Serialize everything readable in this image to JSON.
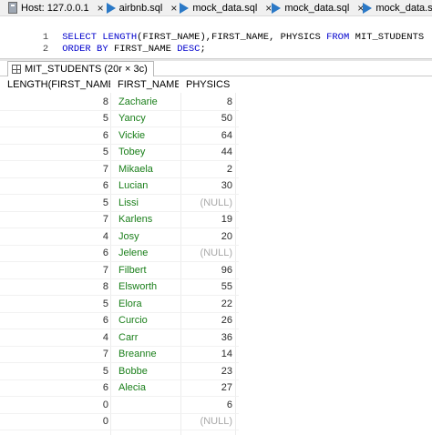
{
  "tabs": [
    {
      "label": "Host: 127.0.0.1",
      "icon": "host-icon"
    },
    {
      "label": "airbnb.sql",
      "icon": "query-run-icon"
    },
    {
      "label": "mock_data.sql",
      "icon": "query-run-icon"
    },
    {
      "label": "mock_data.sql",
      "icon": "query-run-icon"
    },
    {
      "label": "mock_data.sql*",
      "icon": "query-run-icon"
    }
  ],
  "close_glyph": "×",
  "editor": {
    "lines": [
      {
        "num": "1",
        "parts": [
          {
            "t": "SELECT ",
            "k": "kw"
          },
          {
            "t": "LENGTH",
            "k": "kw"
          },
          {
            "t": "(FIRST_NAME),FIRST_NAME, PHYSICS ",
            "k": "ident"
          },
          {
            "t": "FROM ",
            "k": "kw"
          },
          {
            "t": "MIT_STUDENTS",
            "k": "ident"
          }
        ]
      },
      {
        "num": "2",
        "parts": [
          {
            "t": "ORDER BY ",
            "k": "kw"
          },
          {
            "t": "FIRST_NAME ",
            "k": "ident"
          },
          {
            "t": "DESC",
            "k": "kw"
          },
          {
            "t": ";",
            "k": "ident"
          }
        ]
      }
    ]
  },
  "result_tab": {
    "label": "MIT_STUDENTS (20r × 3c)"
  },
  "columns": [
    "LENGTH(FIRST_NAME)",
    "FIRST_NAME",
    "PHYSICS"
  ],
  "null_text": "(NULL)",
  "rows": [
    [
      "8",
      "Zacharie",
      "8"
    ],
    [
      "5",
      "Yancy",
      "50"
    ],
    [
      "6",
      "Vickie",
      "64"
    ],
    [
      "5",
      "Tobey",
      "44"
    ],
    [
      "7",
      "Mikaela",
      "2"
    ],
    [
      "6",
      "Lucian",
      "30"
    ],
    [
      "5",
      "Lissi",
      null
    ],
    [
      "7",
      "Karlens",
      "19"
    ],
    [
      "4",
      "Josy",
      "20"
    ],
    [
      "6",
      "Jelene",
      null
    ],
    [
      "7",
      "Filbert",
      "96"
    ],
    [
      "8",
      "Elsworth",
      "55"
    ],
    [
      "5",
      "Elora",
      "22"
    ],
    [
      "6",
      "Curcio",
      "26"
    ],
    [
      "4",
      "Carr",
      "36"
    ],
    [
      "7",
      "Breanne",
      "14"
    ],
    [
      "5",
      "Bobbe",
      "23"
    ],
    [
      "6",
      "Alecia",
      "27"
    ],
    [
      "0",
      "",
      "6"
    ],
    [
      "0",
      "",
      null
    ]
  ],
  "colors": {
    "name_text": "#1a7f1a",
    "keyword": "#0000cc",
    "null_text": "#a8a8a8",
    "run_icon": "#2a78c6"
  }
}
